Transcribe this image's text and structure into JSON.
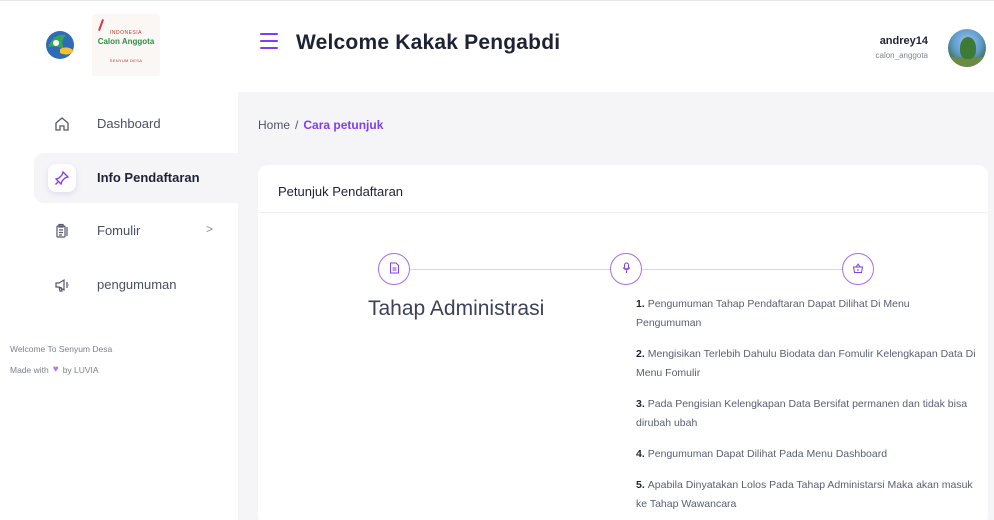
{
  "header": {
    "logo_text": {
      "country": "INDONESIA",
      "main": "Calon Anggota",
      "sub": "SENYUM DESA"
    },
    "title": "Welcome Kakak Pengabdi",
    "user": {
      "name": "andrey14",
      "role": "calon_anggota"
    }
  },
  "sidebar": {
    "items": [
      {
        "label": "Dashboard",
        "icon": "home-icon",
        "active": false
      },
      {
        "label": "Info Pendaftaran",
        "icon": "pin-icon",
        "active": true
      },
      {
        "label": "Fomulir",
        "icon": "clipboard-icon",
        "active": false,
        "has_submenu": true,
        "chevron": ">"
      },
      {
        "label": "pengumuman",
        "icon": "megaphone-icon",
        "active": false
      }
    ],
    "footer": {
      "line1": "Welcome To Senyum Desa",
      "made_with": "Made with",
      "by": "by LUVIA"
    }
  },
  "breadcrumb": {
    "home": "Home",
    "separator": "/",
    "current": "Cara petunjuk"
  },
  "card": {
    "title": "Petunjuk Pendaftaran",
    "steps": [
      {
        "icon": "document-icon"
      },
      {
        "icon": "microphone-icon"
      },
      {
        "icon": "basket-icon"
      }
    ],
    "step_title": "Tahap Administrasi",
    "instructions": [
      {
        "num": "1.",
        "text": "Pengumuman Tahap Pendaftaran Dapat Dilihat Di Menu Pengumuman"
      },
      {
        "num": "2.",
        "text": "Mengisikan Terlebih Dahulu Biodata dan Fomulir Kelengkapan Data Di Menu Fomulir"
      },
      {
        "num": "3.",
        "text": "Pada Pengisian Kelengkapan Data Bersifat permanen dan tidak bisa dirubah ubah"
      },
      {
        "num": "4.",
        "text": "Pengumuman Dapat Dilihat Pada Menu Dashboard"
      },
      {
        "num": "5.",
        "text": "Apabila Dinyatakan Lolos Pada Tahap Administarsi Maka akan masuk ke Tahap Wawancara"
      }
    ]
  },
  "colors": {
    "accent": "#7c3ff2",
    "background": "#f5f5f8",
    "heart": "#b37ce0"
  }
}
